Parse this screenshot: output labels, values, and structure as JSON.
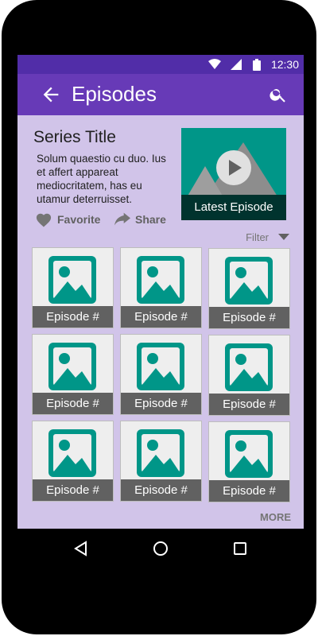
{
  "status": {
    "time": "12:30",
    "icons": [
      "wifi-icon",
      "signal-icon",
      "battery-icon"
    ]
  },
  "appbar": {
    "title": "Episodes",
    "back_icon": "arrow-back-icon",
    "search_icon": "search-icon"
  },
  "series": {
    "title": "Series Title",
    "description": "Solum quaestio cu duo. Ius et affert appareat mediocritatem, has eu utamur deterruisset.",
    "favorite_label": "Favorite",
    "share_label": "Share"
  },
  "latest": {
    "caption": "Latest Episode"
  },
  "filter": {
    "label": "Filter"
  },
  "episodes": [
    {
      "label": "Episode #"
    },
    {
      "label": "Episode #"
    },
    {
      "label": "Episode #"
    },
    {
      "label": "Episode #"
    },
    {
      "label": "Episode #"
    },
    {
      "label": "Episode #"
    },
    {
      "label": "Episode #"
    },
    {
      "label": "Episode #"
    },
    {
      "label": "Episode #"
    }
  ],
  "more_label": "MORE",
  "colors": {
    "primary": "#673ab7",
    "primary_dark": "#512da8",
    "background": "#d1c4e9",
    "accent": "#009688"
  }
}
